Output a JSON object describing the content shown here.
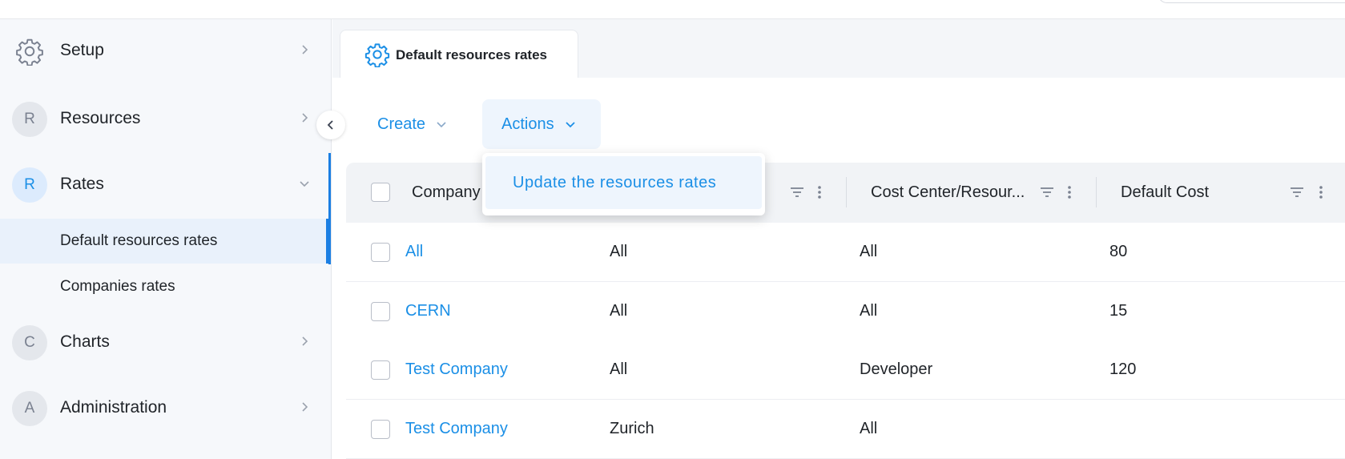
{
  "sidebar": {
    "items": [
      {
        "label": "Setup",
        "icon": "gear-icon"
      },
      {
        "label": "Resources",
        "avatar": "R"
      },
      {
        "label": "Rates",
        "avatar": "R"
      },
      {
        "label": "Charts",
        "avatar": "C"
      },
      {
        "label": "Administration",
        "avatar": "A"
      }
    ],
    "subitems": [
      {
        "label": "Default resources rates"
      },
      {
        "label": "Companies rates"
      }
    ]
  },
  "tab": {
    "label": "Default resources rates",
    "icon": "gear-icon"
  },
  "toolbar": {
    "create_label": "Create",
    "actions_label": "Actions"
  },
  "actions_menu": {
    "items": [
      "Update the resources rates"
    ]
  },
  "table": {
    "headers": [
      "Company",
      "",
      "Cost Center/Resour...",
      "Default Cost"
    ],
    "rows": [
      {
        "company": "All",
        "col2": "All",
        "cost_center": "All",
        "default_cost": "80"
      },
      {
        "company": "CERN",
        "col2": "All",
        "cost_center": "All",
        "default_cost": "15"
      },
      {
        "company": "Test Company",
        "col2": "All",
        "cost_center": "Developer",
        "default_cost": "120"
      },
      {
        "company": "Test Company",
        "col2": "Zurich",
        "cost_center": "All",
        "default_cost": ""
      }
    ]
  },
  "colors": {
    "accent": "#1b8fe6",
    "sidebar_bg": "#f6f8fb",
    "active_bg": "#e9f1fb"
  }
}
